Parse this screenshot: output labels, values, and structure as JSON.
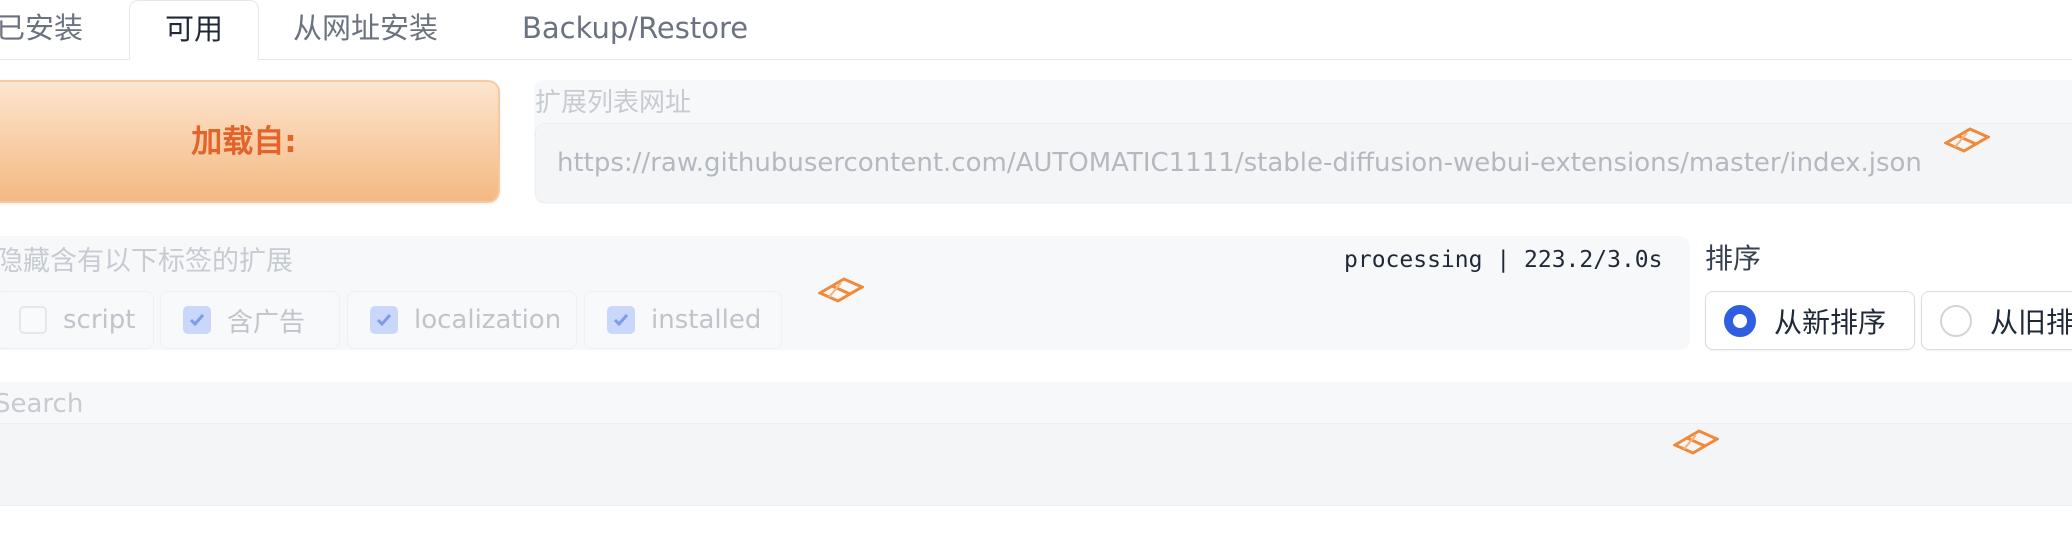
{
  "tabs": [
    {
      "label": "已安装"
    },
    {
      "label": "可用"
    },
    {
      "label": "从网址安装"
    },
    {
      "label": "Backup/Restore"
    }
  ],
  "active_tab": "可用",
  "load_button": {
    "label": "加载自:"
  },
  "extension_list": {
    "label": "扩展列表网址",
    "value": "https://raw.githubusercontent.com/AUTOMATIC1111/stable-diffusion-webui-extensions/master/index.json"
  },
  "hide_tags": {
    "label": "隐藏含有以下标签的扩展",
    "status": "processing | 223.2/3.0s",
    "options": [
      {
        "label": "script",
        "checked": false
      },
      {
        "label": "含广告",
        "checked": true
      },
      {
        "label": "localization",
        "checked": true
      },
      {
        "label": "installed",
        "checked": true
      }
    ]
  },
  "sort": {
    "label": "排序",
    "options": [
      {
        "label": "从新排序",
        "selected": true
      },
      {
        "label": "从旧排序",
        "selected": false
      }
    ]
  },
  "search": {
    "label": "Search",
    "value": ""
  },
  "colors": {
    "accent": "#2f5fe0",
    "orange": "#e4632a",
    "loader": "#f08a3a"
  },
  "icons": [
    "check-icon",
    "loading-spinner-icon"
  ]
}
